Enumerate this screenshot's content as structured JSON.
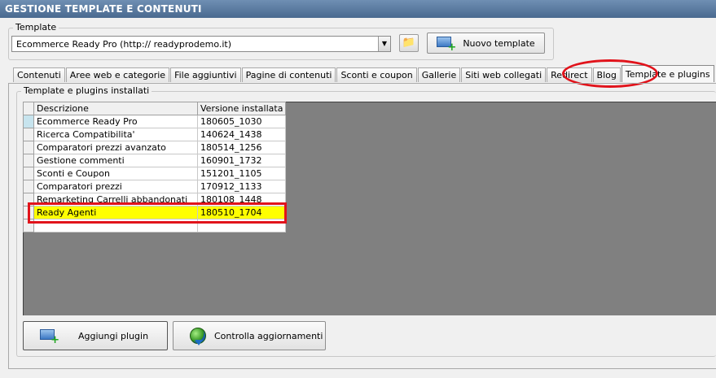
{
  "window": {
    "title": "GESTIONE TEMPLATE E CONTENUTI"
  },
  "template_group": {
    "label": "Template",
    "selected": "Ecommerce Ready Pro (http://          readyprodemo.it)",
    "new_button": "Nuovo template"
  },
  "tabs": [
    {
      "label": "Contenuti"
    },
    {
      "label": "Aree web e categorie"
    },
    {
      "label": "File aggiuntivi"
    },
    {
      "label": "Pagine di contenuti"
    },
    {
      "label": "Sconti e coupon"
    },
    {
      "label": "Gallerie"
    },
    {
      "label": "Siti web collegati"
    },
    {
      "label": "Redirect"
    },
    {
      "label": "Blog"
    },
    {
      "label": "Template e plugins",
      "active": true
    }
  ],
  "plugins_group": {
    "label": "Template e plugins installati",
    "columns": [
      "Descrizione",
      "Versione installata"
    ],
    "rows": [
      {
        "name": "Ecommerce Ready Pro",
        "version": "180605_1030"
      },
      {
        "name": "Ricerca Compatibilita'",
        "version": "140624_1438"
      },
      {
        "name": "Comparatori prezzi avanzato",
        "version": "180514_1256"
      },
      {
        "name": "Gestione commenti",
        "version": "160901_1732"
      },
      {
        "name": "Sconti e Coupon",
        "version": "151201_1105"
      },
      {
        "name": "Comparatori prezzi",
        "version": "170912_1133"
      },
      {
        "name": "Remarketing Carrelli abbandonati",
        "version": "180108_1448"
      },
      {
        "name": "Ready Agenti",
        "version": "180510_1704"
      }
    ]
  },
  "buttons": {
    "add_plugin": "Aggiungi plugin",
    "check_updates": "Controlla aggiornamenti"
  },
  "colors": {
    "titlebar": "#49698f",
    "highlight_row": "#ffff00",
    "annotation_red": "#e1131b",
    "grid_background": "#808080"
  }
}
